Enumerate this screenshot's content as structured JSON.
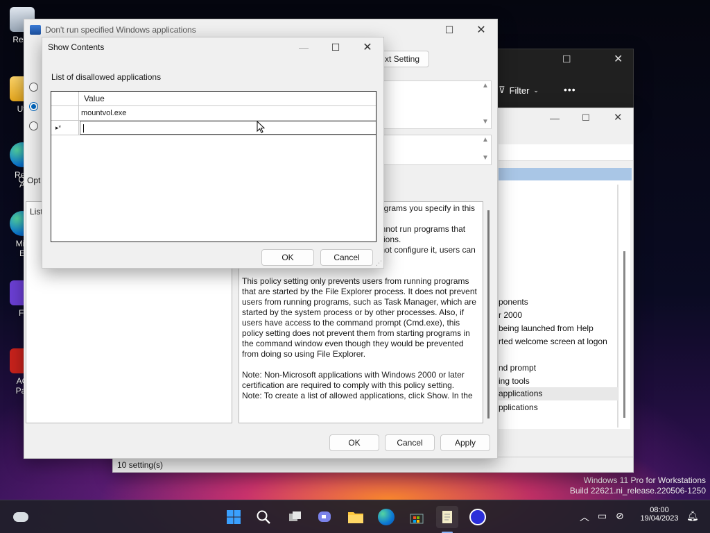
{
  "desktop": {
    "icons": [
      {
        "label": "Recy",
        "name": "recycle-bin"
      },
      {
        "label": "Uti",
        "name": "utilities"
      },
      {
        "label": "Ren",
        "name": "edge-remote"
      },
      {
        "label": "A",
        "name": "edge-remote-2"
      },
      {
        "label": "Opt",
        "name": "options"
      },
      {
        "label": "Mic",
        "name": "microsoft-edge"
      },
      {
        "label": "E",
        "name": "edge-2"
      },
      {
        "label": "Fl",
        "name": "flow"
      },
      {
        "label": "AC",
        "name": "acrobat"
      },
      {
        "label": "Par",
        "name": "acrobat-2"
      }
    ]
  },
  "watermark": {
    "line1": "Windows 11 Pro for Workstations",
    "line2": "Build 22621.ni_release.220506-1250"
  },
  "bg_explorer": {
    "filter_label": "Filter",
    "more_label": "•••"
  },
  "gpedit": {
    "status": "10 setting(s)",
    "items": [
      "ponents",
      "r 2000",
      "being launched from Help",
      "rted welcome screen at logon",
      "nd prompt",
      "ing tools",
      "applications",
      "pplications"
    ]
  },
  "policy": {
    "title": "Don't run specified Windows applications",
    "next_setting": "xt Setting",
    "options_label": "Opt",
    "list_label": "List",
    "help": [
      "rograms you specify in this",
      "annot run programs that",
      "ations.",
      "If you disable this policy setting or do not configure it, users can run any programs.",
      "This policy setting only prevents users from running programs that are started by the File Explorer process. It does not prevent users from running programs, such as Task Manager, which are started by the system process or by other processes.  Also, if users have access to the command prompt (Cmd.exe), this policy setting does not prevent them from starting programs in the command window even though they would be prevented from doing so using File Explorer.",
      "Note: Non-Microsoft applications with Windows 2000 or later certification are required to comply with this policy setting.",
      "Note: To create a list of allowed applications, click Show.  In the"
    ],
    "ok": "OK",
    "cancel": "Cancel",
    "apply": "Apply"
  },
  "show_contents": {
    "title": "Show Contents",
    "list_label": "List of disallowed applications",
    "column_header": "Value",
    "rows": [
      {
        "marker": "",
        "value": "mountvol.exe"
      },
      {
        "marker": "▸*",
        "value": ""
      }
    ],
    "ok": "OK",
    "cancel": "Cancel"
  },
  "taskbar": {
    "time": "08:00",
    "date": "19/04/2023"
  },
  "colors": {
    "accent": "#0067c0",
    "selected_row": "#cce8ff"
  }
}
